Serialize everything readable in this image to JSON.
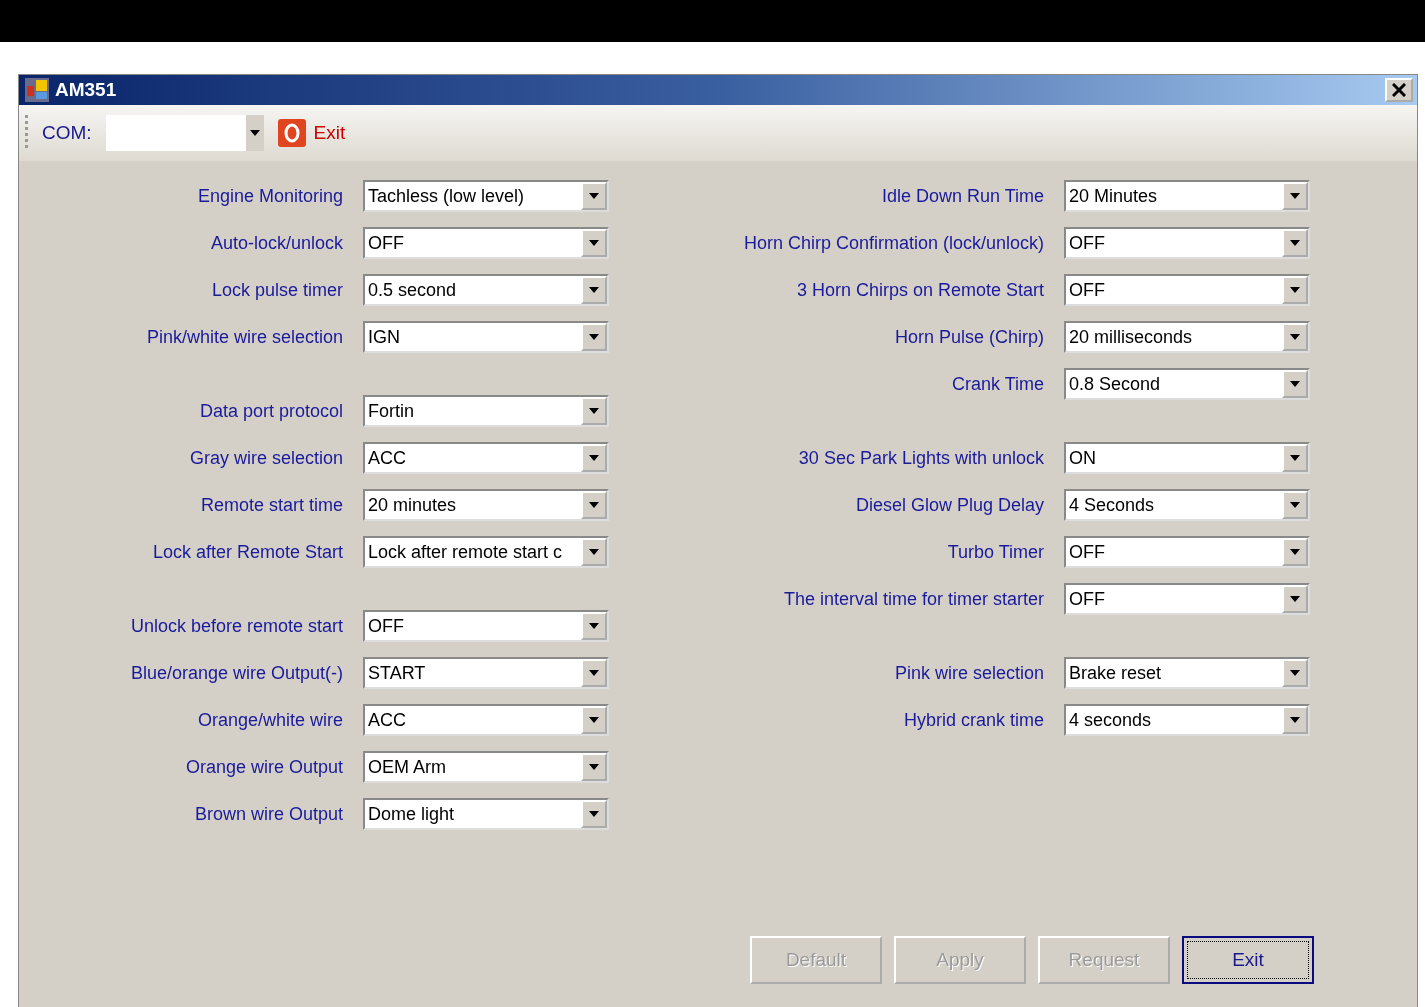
{
  "window": {
    "title": "AM351"
  },
  "toolbar": {
    "com_label": "COM:",
    "exit_label": "Exit"
  },
  "left_groups": [
    [
      {
        "label": "Engine Monitoring",
        "value": "Tachless (low level)"
      },
      {
        "label": "Auto-lock/unlock",
        "value": "OFF"
      },
      {
        "label": "Lock pulse timer",
        "value": "0.5 second"
      },
      {
        "label": "Pink/white wire selection",
        "value": "IGN"
      }
    ],
    [
      {
        "label": "Data port protocol",
        "value": "Fortin"
      },
      {
        "label": "Gray wire selection",
        "value": "ACC"
      },
      {
        "label": "Remote start time",
        "value": "20 minutes"
      },
      {
        "label": "Lock after Remote Start",
        "value": "Lock after remote start c"
      }
    ],
    [
      {
        "label": "Unlock before remote start",
        "value": "OFF"
      },
      {
        "label": "Blue/orange wire Output(-)",
        "value": "START"
      },
      {
        "label": "Orange/white wire",
        "value": "ACC"
      },
      {
        "label": "Orange wire Output",
        "value": "OEM Arm"
      },
      {
        "label": "Brown wire Output",
        "value": "Dome light"
      }
    ]
  ],
  "right_groups": [
    [
      {
        "label": "Idle Down Run Time",
        "value": "20 Minutes"
      },
      {
        "label": "Horn Chirp Confirmation (lock/unlock)",
        "value": "OFF"
      },
      {
        "label": "3 Horn Chirps on Remote Start",
        "value": "OFF"
      },
      {
        "label": "Horn Pulse (Chirp)",
        "value": "20 milliseconds"
      },
      {
        "label": "Crank Time",
        "value": "0.8 Second"
      }
    ],
    [
      {
        "label": "30 Sec Park Lights with unlock",
        "value": "ON"
      },
      {
        "label": "Diesel Glow Plug Delay",
        "value": "4 Seconds"
      },
      {
        "label": "Turbo Timer",
        "value": "OFF"
      },
      {
        "label": "The interval time for timer starter",
        "value": "OFF"
      }
    ],
    [
      {
        "label": "Pink wire selection",
        "value": "Brake reset"
      },
      {
        "label": "Hybrid crank time",
        "value": "4 seconds"
      }
    ]
  ],
  "buttons": [
    {
      "label": "Default",
      "disabled": true,
      "selected": false
    },
    {
      "label": "Apply",
      "disabled": true,
      "selected": false
    },
    {
      "label": "Request",
      "disabled": true,
      "selected": false
    },
    {
      "label": "Exit",
      "disabled": false,
      "selected": true
    }
  ]
}
